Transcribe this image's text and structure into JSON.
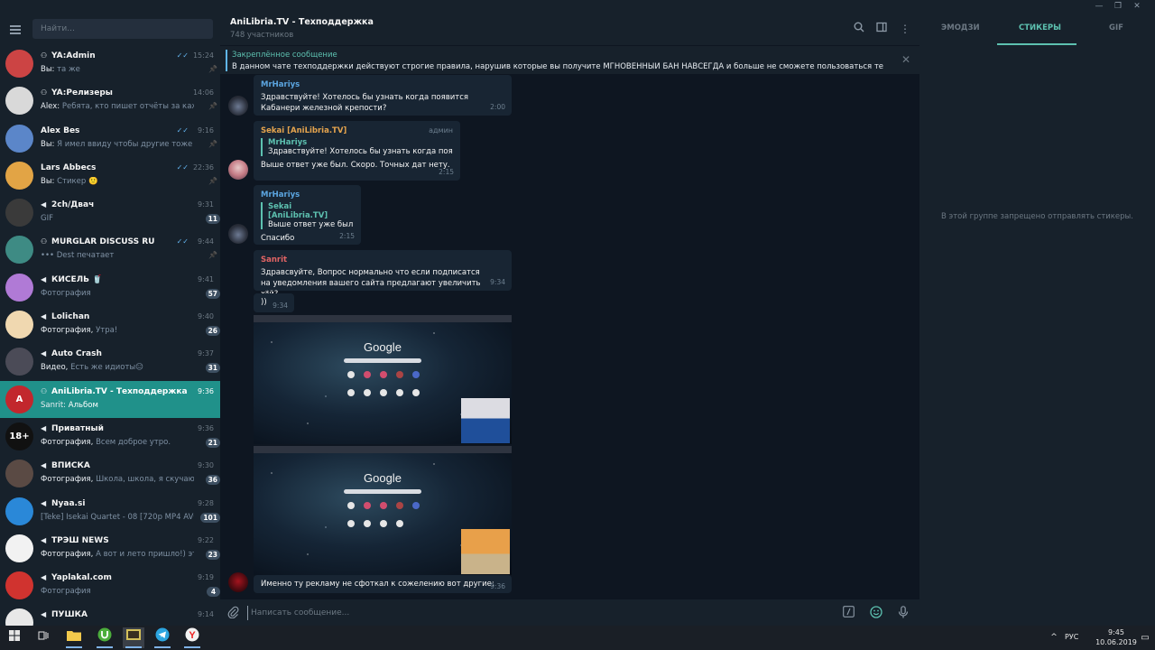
{
  "app": {
    "accent": "#5dc1b0",
    "active_chat_bg": "#20918a"
  },
  "sidebar": {
    "search_placeholder": "Найти...",
    "chats": [
      {
        "name": "YA:Admin",
        "type": "group",
        "time": "15:24",
        "read": true,
        "sender": "Вы:",
        "preview": "та же",
        "pinned": true,
        "avatar_color": "#c44"
      },
      {
        "name": "YA:Релизеры",
        "type": "group",
        "time": "14:06",
        "read": false,
        "sender": "Alex:",
        "preview": "Ребята, кто пишет отчёты за кажды...",
        "pinned": true,
        "avatar_color": "#d9d9d9"
      },
      {
        "name": "Alex Bes",
        "type": "user",
        "time": "9:16",
        "read": true,
        "sender": "Вы:",
        "preview": "Я имел ввиду чтобы другие тоже зал...",
        "pinned": true,
        "avatar_color": "#5b86c9"
      },
      {
        "name": "Lars Abbecs",
        "type": "user",
        "time": "22:36",
        "read": true,
        "sender": "Вы:",
        "preview": "Стикер 🙂",
        "pinned": true,
        "avatar_color": "#e2a445"
      },
      {
        "name": "2ch/Двач",
        "type": "channel",
        "time": "9:31",
        "read": false,
        "sender": "",
        "preview": "GIF",
        "badge": "11",
        "avatar_color": "#3a3a3a"
      },
      {
        "name": "MURGLAR DISCUSS RU",
        "type": "group",
        "time": "9:44",
        "read": true,
        "sender": "",
        "preview": "••• Dest печатает",
        "pinned": true,
        "avatar_color": "#3e8b84"
      },
      {
        "name": "КИСЕЛЬ 🥤",
        "type": "channel",
        "time": "9:41",
        "read": false,
        "sender": "",
        "preview": "Фотография",
        "badge": "57",
        "avatar_color": "#b07ad6"
      },
      {
        "name": "Lolichan",
        "type": "channel",
        "time": "9:40",
        "read": false,
        "sender": "Фотография,",
        "preview": "Утра!",
        "badge": "26",
        "avatar_color": "#f0d8b0"
      },
      {
        "name": "Auto Crash",
        "type": "channel",
        "time": "9:37",
        "read": false,
        "sender": "Видео,",
        "preview": "Есть же идиоты😑",
        "badge": "31",
        "avatar_color": "#4b4b57"
      },
      {
        "name": "AniLibria.TV - Техподдержка",
        "type": "group",
        "time": "9:36",
        "read": false,
        "sender": "Sanrit:",
        "preview": "Альбом",
        "active": true,
        "avatar_color": "#c2272d",
        "avatar_text": "A"
      },
      {
        "name": "Приватный",
        "type": "channel",
        "time": "9:36",
        "read": false,
        "sender": "Фотография,",
        "preview": "Всем доброе утро.",
        "badge": "21",
        "avatar_color": "#111111",
        "avatar_text": "18+"
      },
      {
        "name": "ВПИСКА",
        "type": "channel",
        "time": "9:30",
        "read": false,
        "sender": "Фотография,",
        "preview": "Школа, школа, я скучаю...",
        "badge": "36",
        "avatar_color": "#5a4a44"
      },
      {
        "name": "Nyaa.si",
        "type": "channel",
        "time": "9:28",
        "read": false,
        "sender": "",
        "preview": "[Teke] Isekai Quartet - 08 [720p MP4 AVC...",
        "badge": "101",
        "avatar_color": "#2a88d8"
      },
      {
        "name": "ТРЭШ NEWS",
        "type": "channel",
        "time": "9:22",
        "read": false,
        "sender": "Фотография,",
        "preview": "А вот и лето пришло!) это ...",
        "badge": "23",
        "avatar_color": "#f2f2f2"
      },
      {
        "name": "Yaplakal.com",
        "type": "channel",
        "time": "9:19",
        "read": false,
        "sender": "",
        "preview": "Фотография",
        "badge": "4",
        "avatar_color": "#d0332f"
      },
      {
        "name": "ПУШКА",
        "type": "channel",
        "time": "9:14",
        "read": false,
        "sender": "",
        "preview": "",
        "avatar_color": "#e8e8e8"
      }
    ]
  },
  "header": {
    "title": "AniLibria.TV - Техподдержка",
    "subtitle": "748 участников"
  },
  "pinned": {
    "title": "Закреплённое сообщение",
    "text": "В данном чате техподдержки действуют строгие правила, нарушив которые вы получите МГНОВЕННЫЙ БАН НАВСЕГДА и больше не сможете пользоваться техподдерж..."
  },
  "messages": {
    "m1": {
      "author": "MrHariys",
      "text": "Здравствуйте! Хотелось бы узнать когда появится Кабанери железной крепости?",
      "time": "2:00",
      "author_color": "#5ba5e0"
    },
    "m2": {
      "author": "Sekai [AniLibria.TV]",
      "role": "админ",
      "reply_name": "MrHariys",
      "reply_text": "Здравствуйте! Хотелось бы узнать когда появит...",
      "text": "Выше ответ уже был. Скоро. Точных дат нету.",
      "time": "2:15",
      "author_color": "#e5a44e"
    },
    "m3": {
      "author": "MrHariys",
      "reply_name": "Sekai [AniLibria.TV]",
      "reply_text": "Выше ответ уже был. ...",
      "text": "Спасибо",
      "time": "2:15",
      "author_color": "#5ba5e0"
    },
    "m4": {
      "author": "Sanrit",
      "text": "Здравсвуйте, Вопрос нормально что если подписатся на уведомления вашего сайта предлагают увеличить х*й?",
      "time": "9:34",
      "author_color": "#e26464"
    },
    "m5": {
      "text": "))",
      "time": "9:34"
    },
    "album": {
      "logo_text": "Google"
    },
    "m6": {
      "text": "Именно ту рекламу не сфоткал к сожелению вот другие:",
      "time": "9:36"
    }
  },
  "composer": {
    "placeholder": "Написать сообщение..."
  },
  "right_panel": {
    "tabs": [
      "ЭМОДЗИ",
      "СТИКЕРЫ",
      "GIF"
    ],
    "active_tab": "СТИКЕРЫ",
    "notice": "В этой группе запрещено отправлять стикеры."
  },
  "taskbar": {
    "lang": "РУС",
    "time": "9:45",
    "date": "10.06.2019"
  }
}
